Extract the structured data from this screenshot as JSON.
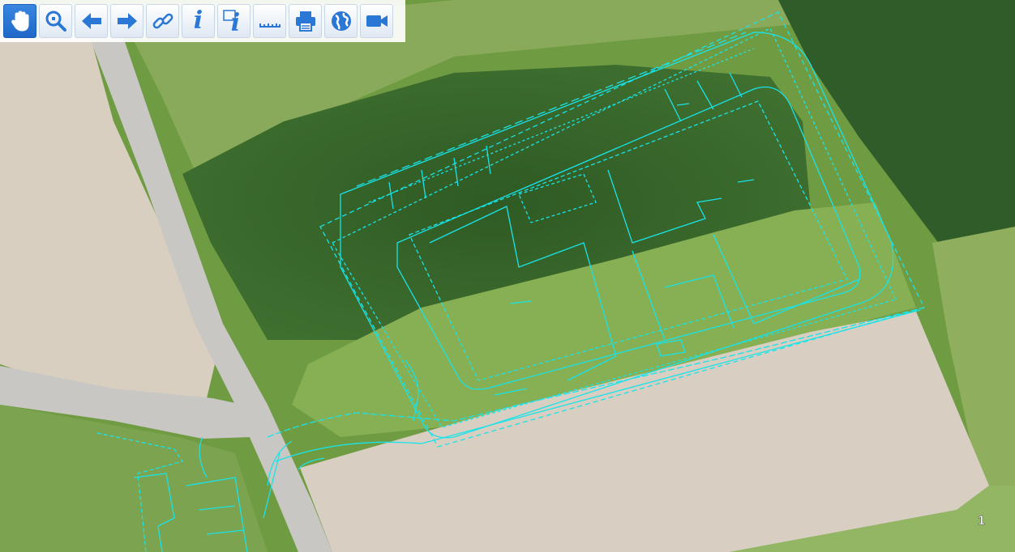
{
  "toolbar": {
    "tools": [
      {
        "name": "pan",
        "icon": "hand-icon",
        "active": true
      },
      {
        "name": "zoom",
        "icon": "magnifier-icon",
        "active": false
      },
      {
        "name": "back",
        "icon": "arrow-left-icon",
        "active": false
      },
      {
        "name": "forward",
        "icon": "arrow-right-icon",
        "active": false
      },
      {
        "name": "link",
        "icon": "link-icon",
        "active": false
      },
      {
        "name": "info",
        "icon": "info-icon",
        "active": false,
        "glyph": "i"
      },
      {
        "name": "area-info",
        "icon": "area-info-icon",
        "active": false,
        "glyph": "i"
      },
      {
        "name": "measure",
        "icon": "ruler-icon",
        "active": false
      },
      {
        "name": "print",
        "icon": "printer-icon",
        "active": false
      },
      {
        "name": "globe",
        "icon": "globe-icon",
        "active": false
      },
      {
        "name": "video",
        "icon": "video-camera-icon",
        "active": false
      }
    ]
  },
  "map": {
    "overlay_color": "#19e3e8",
    "field_color": "#d8cfc2",
    "forest_color": "#35602a",
    "grass_color": "#7aa84a",
    "road_color": "#c9c7c2"
  },
  "corner_mark": "1"
}
